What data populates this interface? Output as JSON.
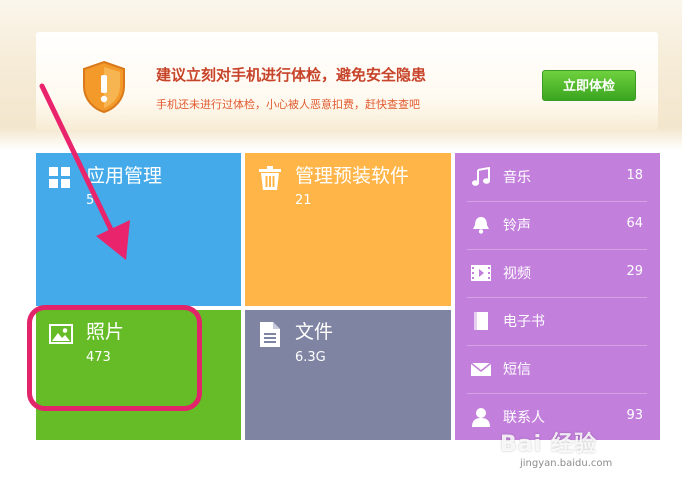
{
  "banner": {
    "title": "建议立刻对手机进行体检，避免安全隐患",
    "subtitle": "手机还未进行过体检，小心被人恶意扣费，赶快查查吧",
    "button_label": "立即体检",
    "icon": "shield-warning-icon"
  },
  "tiles": {
    "apps": {
      "title": "应用管理",
      "count": "5",
      "icon": "apps-grid-icon"
    },
    "preinstalled": {
      "title": "管理预装软件",
      "count": "21",
      "icon": "trash-icon"
    },
    "photos": {
      "title": "照片",
      "count": "473",
      "icon": "photo-icon"
    },
    "files": {
      "title": "文件",
      "count": "6.3G",
      "icon": "file-icon"
    }
  },
  "media": [
    {
      "label": "音乐",
      "count": "18",
      "icon": "music-icon"
    },
    {
      "label": "铃声",
      "count": "64",
      "icon": "bell-icon"
    },
    {
      "label": "视频",
      "count": "29",
      "icon": "video-icon"
    },
    {
      "label": "电子书",
      "count": "",
      "icon": "ebook-icon"
    },
    {
      "label": "短信",
      "count": "",
      "icon": "message-icon"
    },
    {
      "label": "联系人",
      "count": "93",
      "icon": "contact-icon"
    }
  ],
  "watermark": {
    "logo": "Bai 经验",
    "sub": "jingyan.baidu.com"
  },
  "colors": {
    "apps": "#45aae9",
    "preinstalled": "#ffb548",
    "photos": "#66bc27",
    "files": "#7f84a2",
    "media": "#c37fdc",
    "highlight": "#e2246a",
    "button": "#4db62a"
  }
}
